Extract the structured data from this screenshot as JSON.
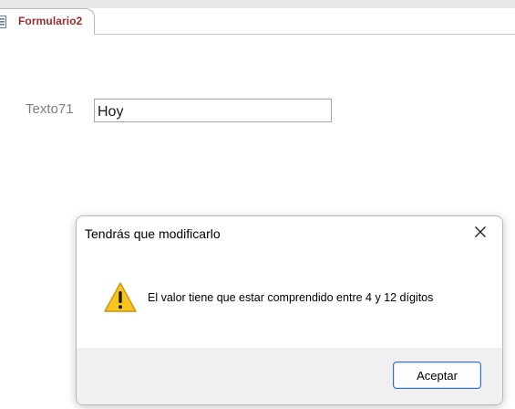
{
  "document_tab": {
    "label": "Formulario2",
    "icon": "form-icon"
  },
  "form": {
    "field_label": "Texto71",
    "field_value": "Hoy"
  },
  "dialog": {
    "title": "Tendrás que modificarlo",
    "message": "El valor tiene que estar comprendido entre 4 y 12 dígitos",
    "icon": "warning-icon",
    "close_icon": "close-icon",
    "ok_label": "Aceptar"
  },
  "colors": {
    "tab_text": "#9c2a2a",
    "button_border": "#2f6fcc",
    "warning_fill": "#f8c51c"
  }
}
